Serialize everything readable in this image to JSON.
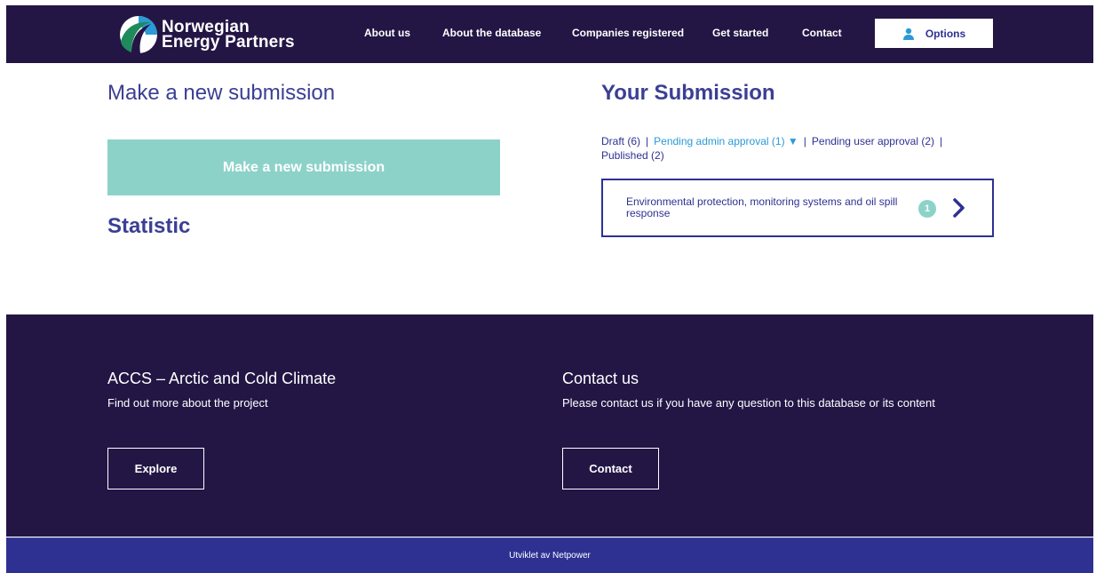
{
  "brand": {
    "line1": "Norwegian",
    "line2": "Energy Partners",
    "icon": "nep-swoosh-logo",
    "colors": {
      "navy": "#231645",
      "blue": "#2e3192",
      "teal": "#8dd2c9",
      "link": "#2b9ad6"
    }
  },
  "nav": {
    "items": [
      "About us",
      "About the database",
      "Companies registered",
      "Get started",
      "Contact"
    ],
    "options_label": "Options",
    "options_icon": "user-icon"
  },
  "left": {
    "heading": "Make a new submission",
    "button_label": "Make a new submission",
    "stat_heading": "Statistic"
  },
  "right": {
    "heading": "Your Submission",
    "filters": [
      {
        "label": "Draft (6)"
      },
      {
        "label": "Pending admin approval (1) ▼",
        "active": true
      },
      {
        "label": "Pending user approval (2)"
      },
      {
        "label": "Published (2)"
      }
    ],
    "separator": "|",
    "card": {
      "text": "Environmental protection, monitoring systems and oil spill response",
      "count": "1",
      "icon": "chevron-right-icon"
    }
  },
  "footer": {
    "left_title": "ACCS – Arctic and Cold Climate",
    "left_desc": "Find out more about the project",
    "left_button": "Explore",
    "right_title": "Contact us",
    "right_desc": "Please contact us if you have any question to this database or its content",
    "right_button": "Contact",
    "credit": "Utviklet av Netpower"
  }
}
